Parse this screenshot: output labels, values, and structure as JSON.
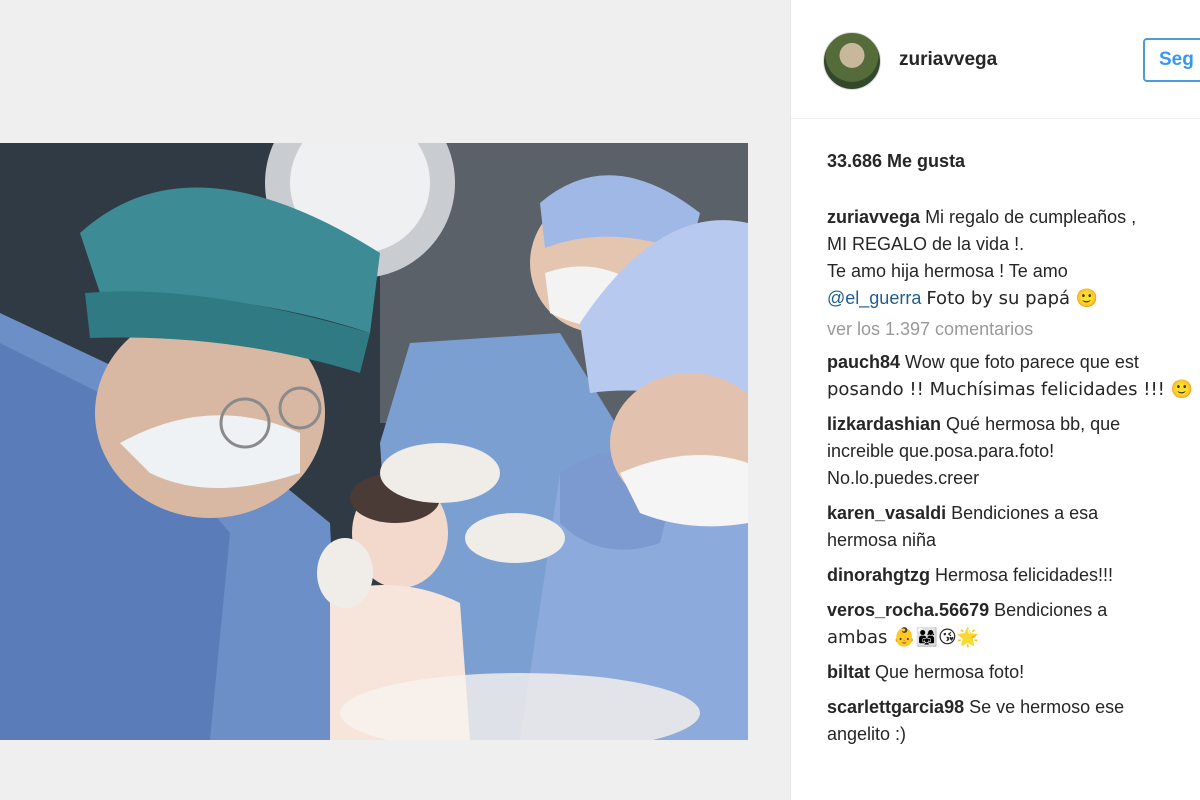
{
  "post": {
    "username": "zuriavvega",
    "follow_label": "Seg",
    "likes": "33.686 Me gusta",
    "caption": {
      "author": "zuriavvega",
      "lines": [
        "Mi regalo de cumpleaños ,",
        "MI REGALO de la vida !.",
        "Te amo hija hermosa ! Te amo"
      ],
      "mention": "@el_guerra",
      "tail": "Foto by su papá 🙂"
    },
    "view_all_comments": "ver los 1.397 comentarios",
    "comments": [
      {
        "author": "pauch84",
        "line1": "Wow que foto parece que est",
        "line2": "posando !! Muchísimas felicidades !!! 🙂"
      },
      {
        "author": "lizkardashian",
        "line1": "Qué hermosa bb, que",
        "line2": "increible que.posa.para.foto!",
        "line3": "No.lo.puedes.creer"
      },
      {
        "author": "karen_vasaldi",
        "line1": "Bendiciones a esa",
        "line2": "hermosa niña"
      },
      {
        "author": "dinorahgtzg",
        "line1": "Hermosa felicidades!!!"
      },
      {
        "author": "veros_rocha.56679",
        "line1": "Bendiciones a",
        "line2": "ambas 👶👨‍👩‍👧😘🌟"
      },
      {
        "author": "biltat",
        "line1": "Que hermosa foto!"
      },
      {
        "author": "scarlettgarcia98",
        "line1": "Se ve hermoso ese",
        "line2": "angelito :)"
      }
    ]
  }
}
